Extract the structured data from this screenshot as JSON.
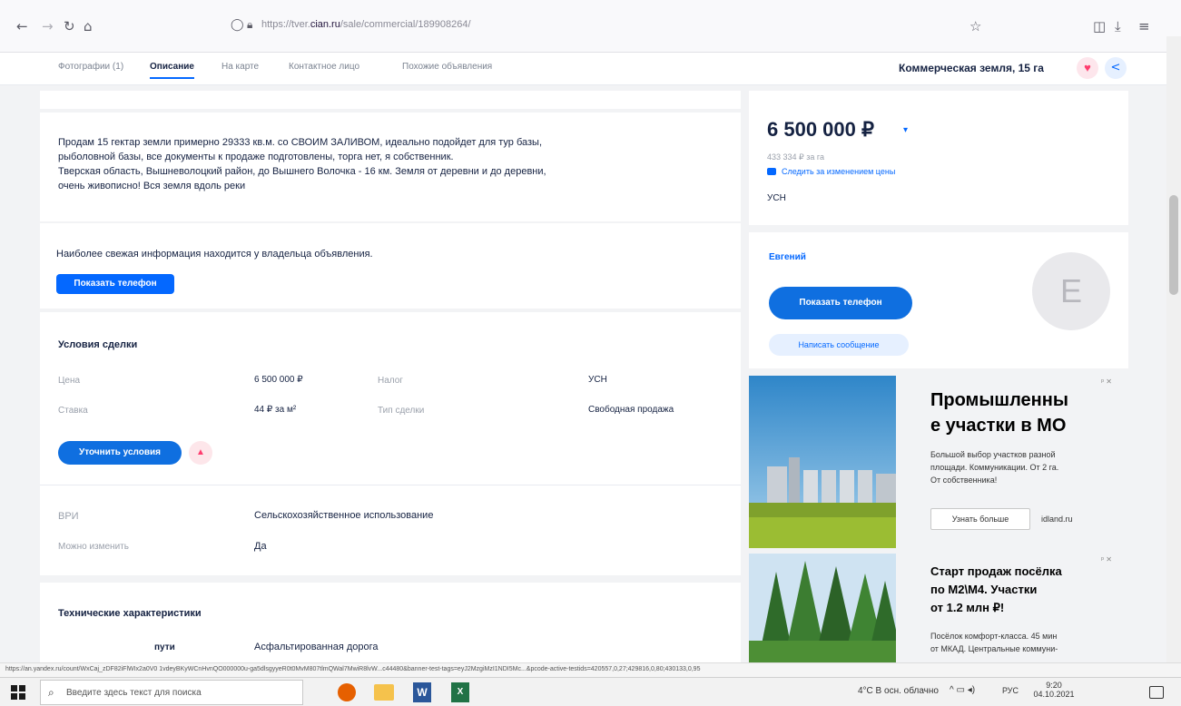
{
  "browser": {
    "url_prefix": "https://tver.",
    "url_domain": "cian.ru",
    "url_rest": "/sale/commercial/189908264/"
  },
  "header": {
    "tabs": [
      {
        "label": "Фотографии (1)"
      },
      {
        "label": "Описание"
      },
      {
        "label": "На карте"
      },
      {
        "label": "Контактное лицо"
      },
      {
        "label": "Похожие объявления"
      }
    ],
    "title": "Коммерческая земля, 15 га"
  },
  "description": {
    "lines": [
      "Продам 15 гектар земли примерно 29333 кв.м. со СВОИМ ЗАЛИВОМ, идеально подойдет для тур базы,",
      "рыболовной базы, все документы к продаже подготовлены, торга нет, я собственник.",
      "Тверская область, Вышневолоцкий район, до Вышнего Волочка - 16 км. Земля от деревни и до деревни,",
      "очень живописно! Вся земля вдоль реки"
    ]
  },
  "owner_info": {
    "text": "Наиболее свежая информация находится у владельца объявления.",
    "phone_button": "Показать телефон"
  },
  "deal": {
    "title": "Условия сделки",
    "price_label": "Цена",
    "price_value": "6 500 000 ₽",
    "tax_label": "Налог",
    "tax_value": "УСН",
    "rate_label": "Ставка",
    "rate_value": "44 ₽ за м²",
    "deal_type_label": "Тип сделки",
    "deal_type_value": "Свободная продажа",
    "clarify_button": "Уточнить условия",
    "vri_label": "ВРИ",
    "vri_value": "Сельскохозяйственное использование",
    "can_change_label": "Можно изменить",
    "can_change_value": "Да"
  },
  "tech": {
    "title": "Технические характеристики",
    "road_label": "пути",
    "road_value": "Асфальтированная дорога"
  },
  "price_card": {
    "price": "6 500 000 ₽",
    "per_unit": "433 334 ₽ за га",
    "watch_link": "Следить за изменением цены",
    "tax": "УСН"
  },
  "contact": {
    "name": "Евгений",
    "avatar_letter": "Е",
    "phone_button": "Показать телефон",
    "message_button": "Написать сообщение"
  },
  "ads": [
    {
      "title": "Промышленные участки в МО",
      "title_line1": "Промышленны",
      "title_line2": "е участки в МО",
      "text_line1": "Большой выбор участков разной",
      "text_line2": "площади. Коммуникации. От 2 га.",
      "text_line3": "От собственника!",
      "button": "Узнать больше",
      "domain": "idland.ru"
    },
    {
      "title_line1": "Старт продаж посёлка",
      "title_line2": "по М2\\М4. Участки",
      "title_line3": "от 1.2 млн ₽!",
      "text_line1": "Посёлок комфорт-класса. 45 мин",
      "text_line2": "от МКАД. Центральные коммуни-"
    }
  ],
  "status_url": "https://an.yandex.ru/count/WxCaj_zDF82iFlWIx2a0V0 1vdeyBKyWCnHvnQO000000u-ga5dlsgyyeR0t0MvM807tlmQWal7MwiR8lvW...c44480&banner-test-tags=eyJ2MzgiMzI1NDI5Mc...&pcode-active-testids=420557,0,27;429816,0,80;430133,0,95",
  "taskbar": {
    "search_placeholder": "Введите здесь текст для поиска",
    "weather": "4°C В осн. облачно",
    "lang": "РУС",
    "time": "9:20",
    "date": "04.10.2021"
  },
  "colors": {
    "accent": "#0468ff",
    "text": "#152242",
    "muted": "#9aa0ab",
    "background": "#f2f3f5"
  }
}
